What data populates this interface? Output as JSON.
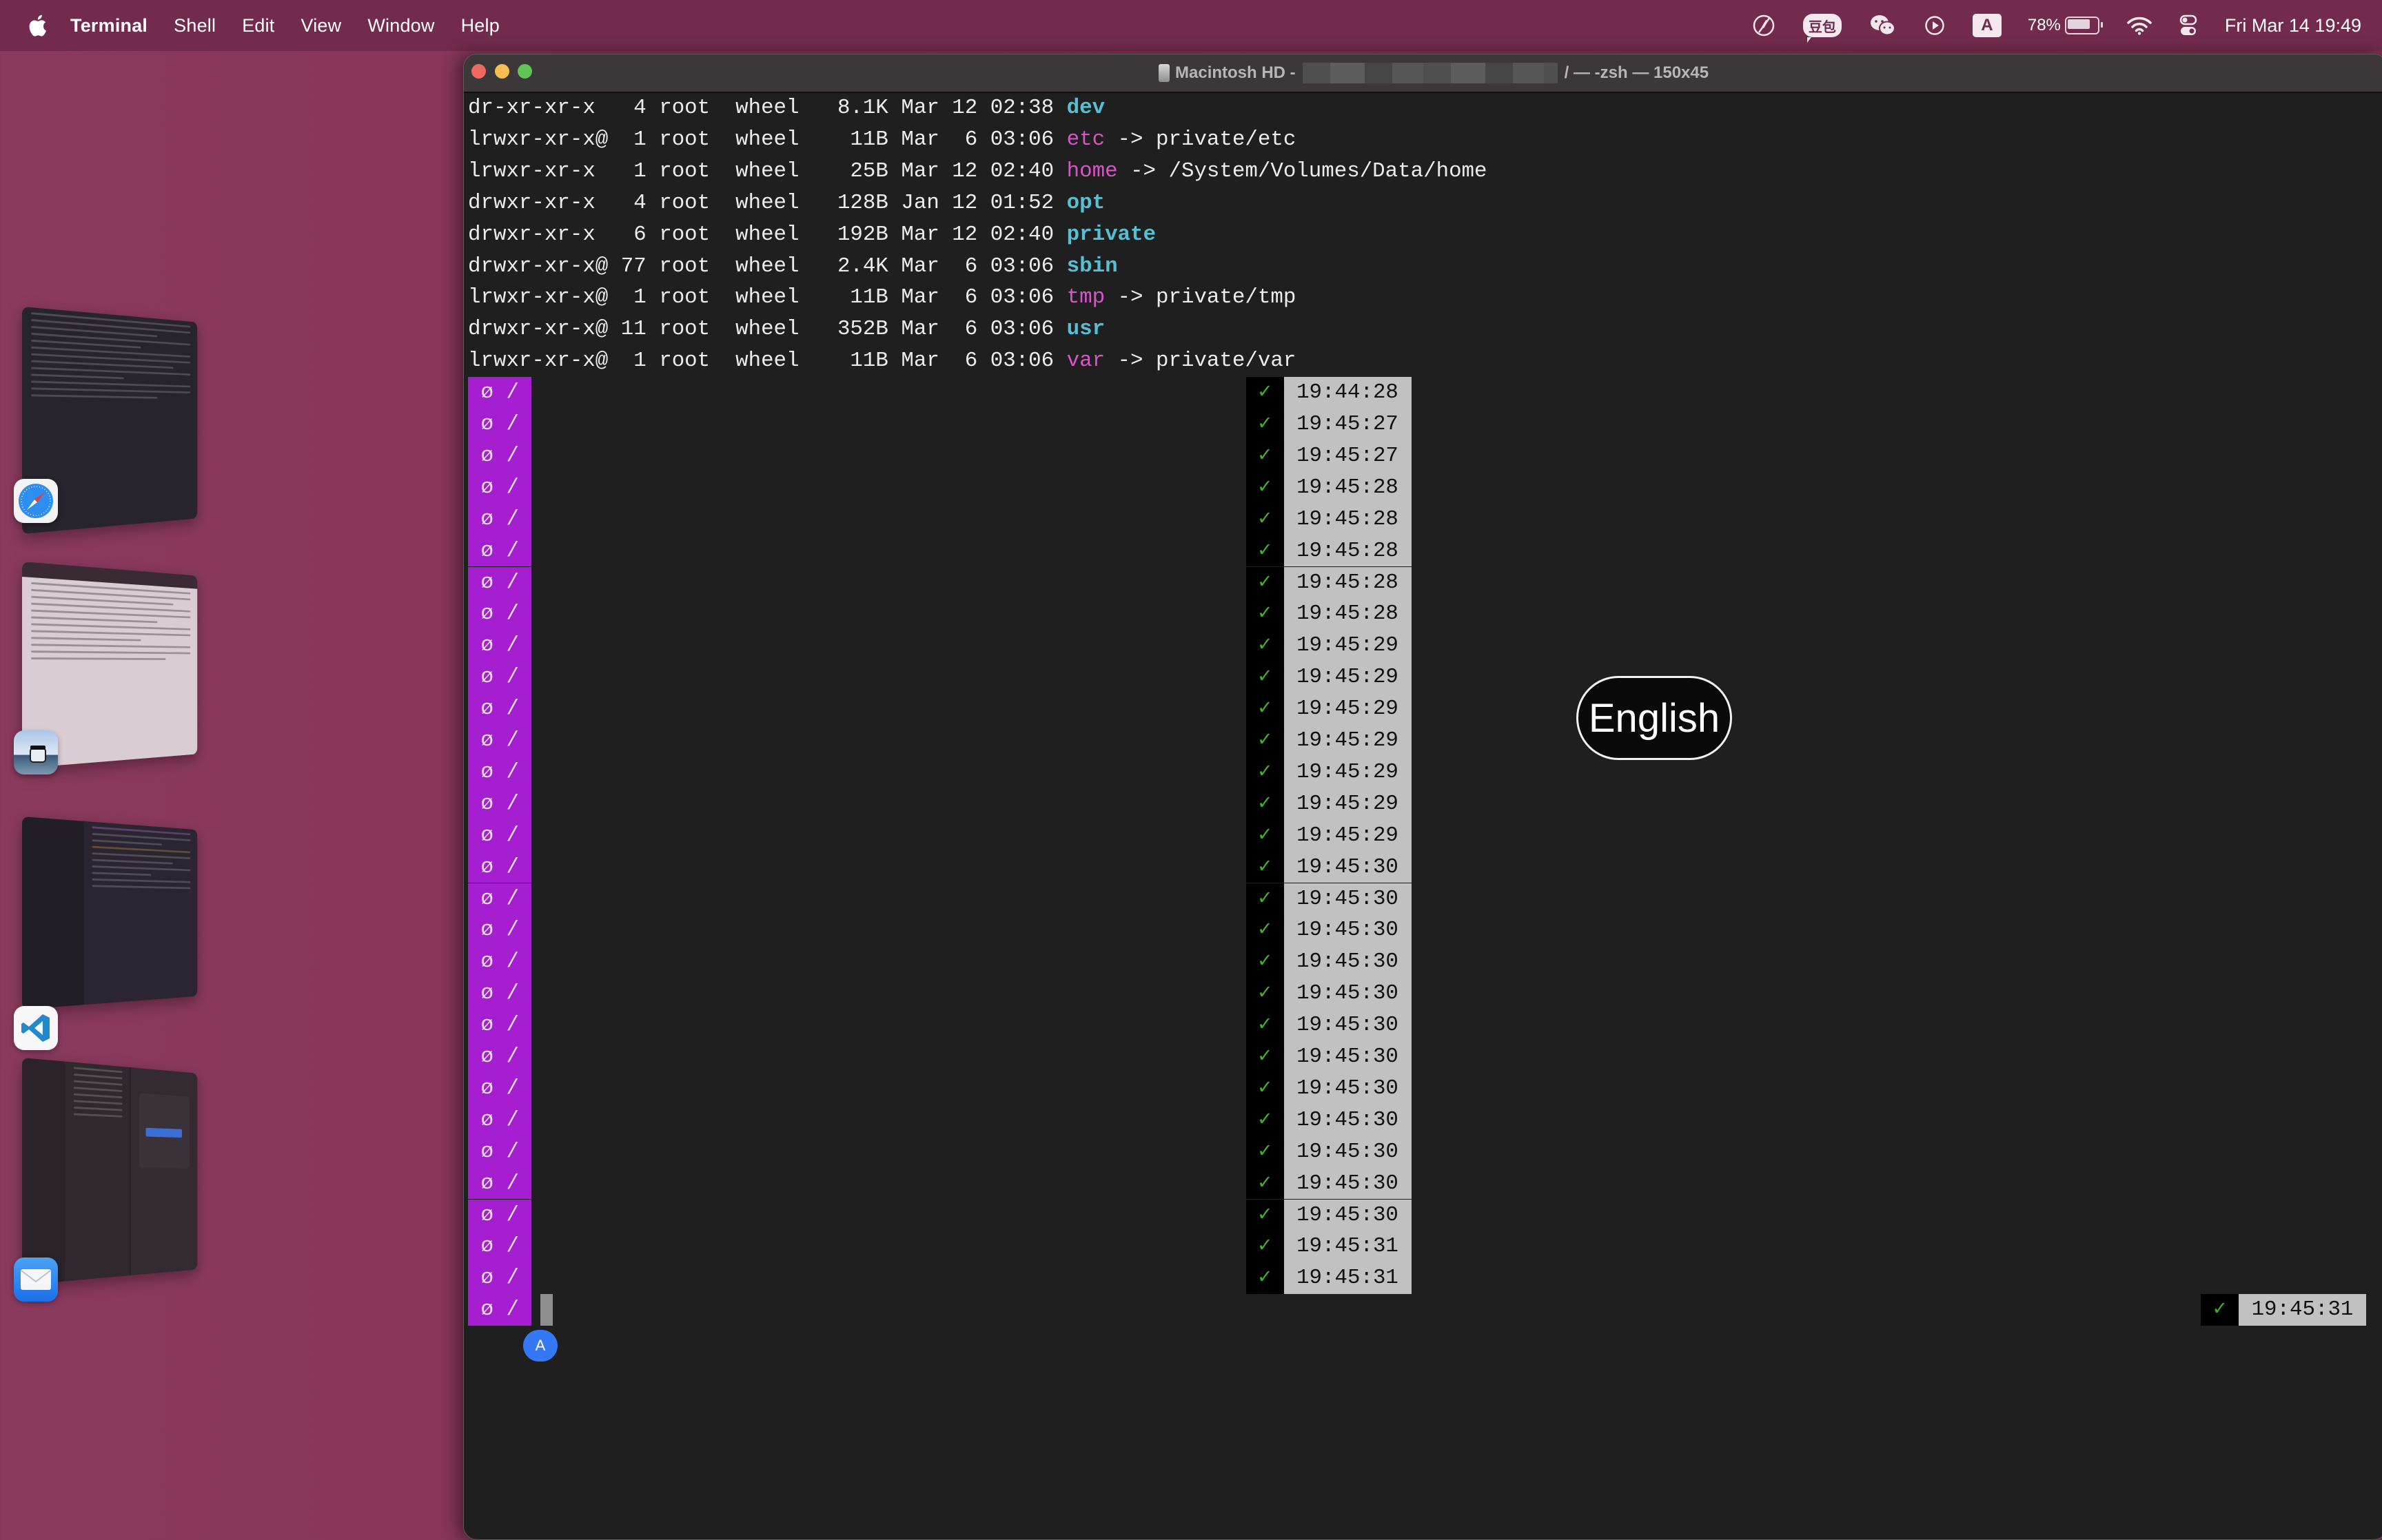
{
  "menubar": {
    "apple_icon": "apple-logo",
    "items": [
      "Terminal",
      "Shell",
      "Edit",
      "View",
      "Window",
      "Help"
    ],
    "status": {
      "icons": [
        "rocket-off-icon",
        "doubao-icon",
        "wechat-icon",
        "play-circle-icon",
        "input-source-icon",
        "battery-icon",
        "wifi-icon",
        "control-center-icon"
      ],
      "doubao_label": "豆包",
      "input_source_label": "A",
      "battery_percent": "78%",
      "datetime": "Fri Mar 14  19:49"
    }
  },
  "stage_manager": {
    "apps": [
      {
        "name": "Safari",
        "icon": "safari-icon"
      },
      {
        "name": "Preview",
        "icon": "preview-icon"
      },
      {
        "name": "Visual Studio Code",
        "icon": "vscode-icon"
      },
      {
        "name": "Mail",
        "icon": "mail-icon"
      }
    ]
  },
  "terminal": {
    "title_prefix": "Macintosh HD -",
    "title_suffix": "/ — -zsh — 150x45",
    "listing": [
      {
        "perm": "dr-xr-xr-x ",
        "links": " 4",
        "owner": "root",
        "group": "wheel",
        "size": "8.1K",
        "month": "Mar",
        "day": "12",
        "time": "02:38",
        "name": "dev",
        "type": "dir",
        "target": ""
      },
      {
        "perm": "lrwxr-xr-x@",
        "links": " 1",
        "owner": "root",
        "group": "wheel",
        "size": " 11B",
        "month": "Mar",
        "day": " 6",
        "time": "03:06",
        "name": "etc",
        "type": "link",
        "target": "private/etc"
      },
      {
        "perm": "lrwxr-xr-x ",
        "links": " 1",
        "owner": "root",
        "group": "wheel",
        "size": " 25B",
        "month": "Mar",
        "day": "12",
        "time": "02:40",
        "name": "home",
        "type": "link",
        "target": "/System/Volumes/Data/home"
      },
      {
        "perm": "drwxr-xr-x ",
        "links": " 4",
        "owner": "root",
        "group": "wheel",
        "size": "128B",
        "month": "Jan",
        "day": "12",
        "time": "01:52",
        "name": "opt",
        "type": "dir",
        "target": ""
      },
      {
        "perm": "drwxr-xr-x ",
        "links": " 6",
        "owner": "root",
        "group": "wheel",
        "size": "192B",
        "month": "Mar",
        "day": "12",
        "time": "02:40",
        "name": "private",
        "type": "dir",
        "target": ""
      },
      {
        "perm": "drwxr-xr-x@",
        "links": "77",
        "owner": "root",
        "group": "wheel",
        "size": "2.4K",
        "month": "Mar",
        "day": " 6",
        "time": "03:06",
        "name": "sbin",
        "type": "dir",
        "target": ""
      },
      {
        "perm": "lrwxr-xr-x@",
        "links": " 1",
        "owner": "root",
        "group": "wheel",
        "size": " 11B",
        "month": "Mar",
        "day": " 6",
        "time": "03:06",
        "name": "tmp",
        "type": "link",
        "target": "private/tmp"
      },
      {
        "perm": "drwxr-xr-x@",
        "links": "11",
        "owner": "root",
        "group": "wheel",
        "size": "352B",
        "month": "Mar",
        "day": " 6",
        "time": "03:06",
        "name": "usr",
        "type": "dir",
        "target": ""
      },
      {
        "perm": "lrwxr-xr-x@",
        "links": " 1",
        "owner": "root",
        "group": "wheel",
        "size": " 11B",
        "month": "Mar",
        "day": " 6",
        "time": "03:06",
        "name": "var",
        "type": "link",
        "target": "private/var"
      }
    ],
    "link_arrow": "->",
    "prompt_left": " ø / ",
    "status_mark": "✓",
    "prompt_times": [
      "19:44:28",
      "19:45:27",
      "19:45:27",
      "19:45:28",
      "19:45:28",
      "19:45:28",
      "19:45:28",
      "19:45:28",
      "19:45:29",
      "19:45:29",
      "19:45:29",
      "19:45:29",
      "19:45:29",
      "19:45:29",
      "19:45:29",
      "19:45:30",
      "19:45:30",
      "19:45:30",
      "19:45:30",
      "19:45:30",
      "19:45:30",
      "19:45:30",
      "19:45:30",
      "19:45:30",
      "19:45:30",
      "19:45:30",
      "19:45:30",
      "19:45:31",
      "19:45:31"
    ],
    "current_prompt_time": "19:45:31",
    "ime_cursor_badge": "A",
    "ime_popup": "English"
  },
  "colors": {
    "prompt_bg": "#a51fd0",
    "dir": "#56bfd1",
    "link": "#d656c8",
    "ok_check": "#43b02a",
    "time_bg": "#c1c1c1",
    "ime_badge": "#3578f6"
  }
}
